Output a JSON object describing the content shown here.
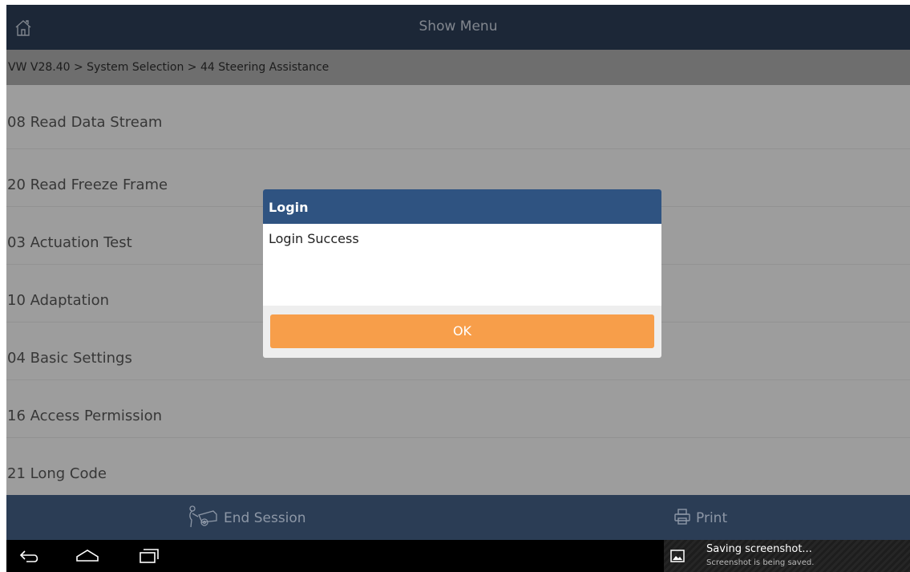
{
  "header": {
    "title": "Show Menu",
    "home_icon": "home-icon"
  },
  "breadcrumb": "VW V28.40 > System Selection > 44 Steering Assistance",
  "menu": {
    "items": [
      {
        "label": "08 Read Data Stream"
      },
      {
        "label": "20 Read Freeze Frame"
      },
      {
        "label": "03 Actuation Test"
      },
      {
        "label": "10 Adaptation"
      },
      {
        "label": "04 Basic Settings"
      },
      {
        "label": "16 Access Permission"
      },
      {
        "label": "21 Long Code"
      }
    ]
  },
  "dialog": {
    "title": "Login",
    "message": "Login Success",
    "ok_label": "OK"
  },
  "footer": {
    "end_session_label": "End Session",
    "end_session_icon": "mechanic-car-icon",
    "print_label": "Print",
    "print_icon": "printer-icon"
  },
  "system_nav": {
    "back_icon": "back-icon",
    "home_icon": "home-outline-icon",
    "recents_icon": "recents-icon"
  },
  "notification": {
    "title": "Saving screenshot...",
    "subtitle": "Screenshot is being saved.",
    "icon": "image-icon"
  },
  "colors": {
    "top_bar": "#2b3d55",
    "dialog_header": "#2f5381",
    "ok_button": "#f79e4a",
    "breadcrumb_bg": "#a9a9a9"
  }
}
